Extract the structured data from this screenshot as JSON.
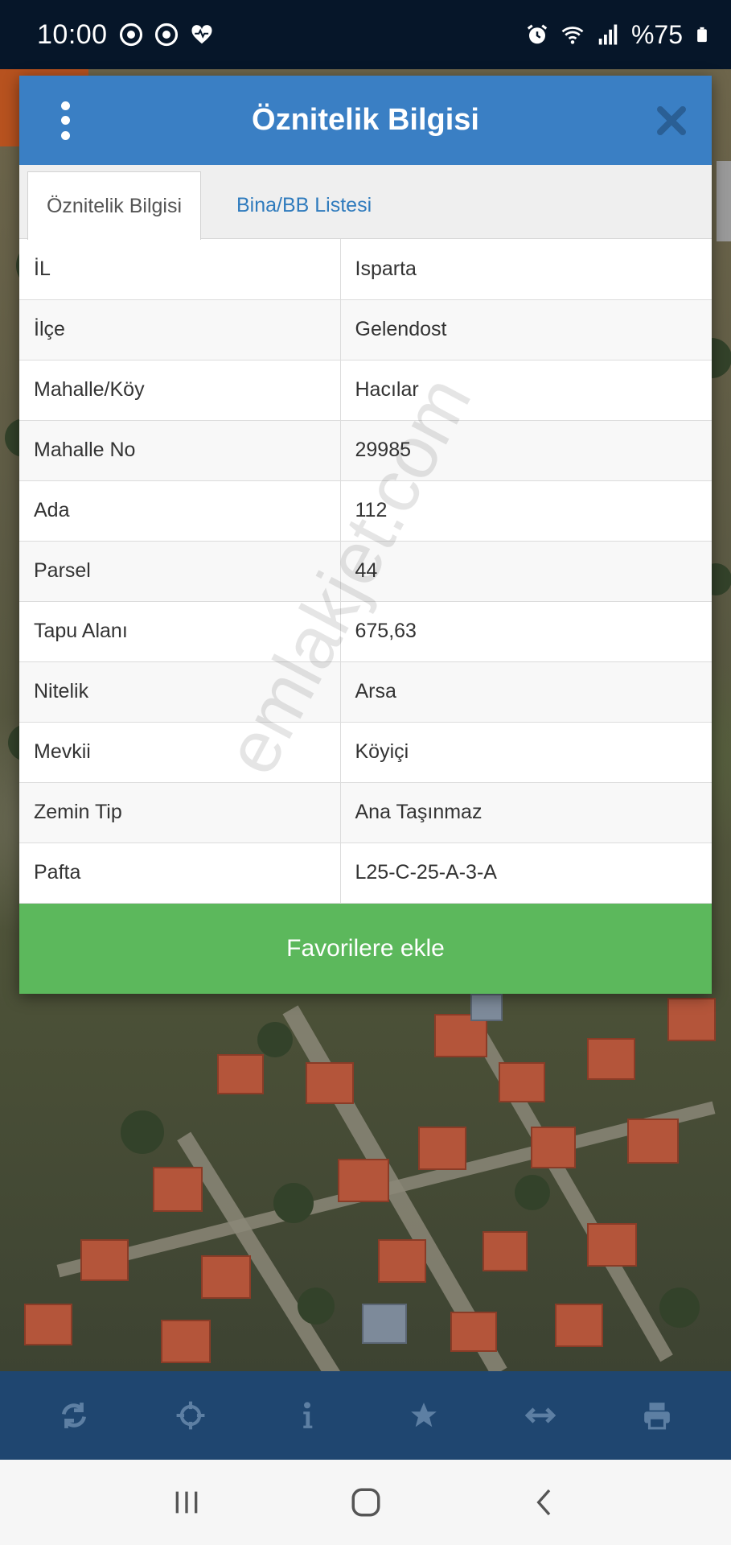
{
  "status_bar": {
    "time": "10:00",
    "battery": "%75"
  },
  "dialog": {
    "title": "Öznitelik Bilgisi",
    "tabs": [
      {
        "label": "Öznitelik Bilgisi",
        "active": true
      },
      {
        "label": "Bina/BB Listesi",
        "active": false
      }
    ],
    "rows": [
      {
        "key": "İL",
        "value": "Isparta"
      },
      {
        "key": "İlçe",
        "value": "Gelendost"
      },
      {
        "key": "Mahalle/Köy",
        "value": "Hacılar"
      },
      {
        "key": "Mahalle No",
        "value": "29985"
      },
      {
        "key": "Ada",
        "value": "112"
      },
      {
        "key": "Parsel",
        "value": "44"
      },
      {
        "key": "Tapu Alanı",
        "value": "675,63"
      },
      {
        "key": "Nitelik",
        "value": "Arsa"
      },
      {
        "key": "Mevkii",
        "value": "Köyiçi"
      },
      {
        "key": "Zemin Tip",
        "value": "Ana Taşınmaz"
      },
      {
        "key": "Pafta",
        "value": "L25-C-25-A-3-A"
      }
    ],
    "favorite_button": "Favorilere ekle"
  },
  "watermark": "emlakjet.com",
  "toolbar": {
    "icons": [
      "refresh-icon",
      "crosshair-icon",
      "info-icon",
      "star-icon",
      "measure-icon",
      "print-icon"
    ]
  },
  "colors": {
    "header": "#3a7fc4",
    "tab_link": "#2f7bbd",
    "favorite": "#5cb85c",
    "toolbar": "#1f4670",
    "status_bar": "#061629"
  }
}
